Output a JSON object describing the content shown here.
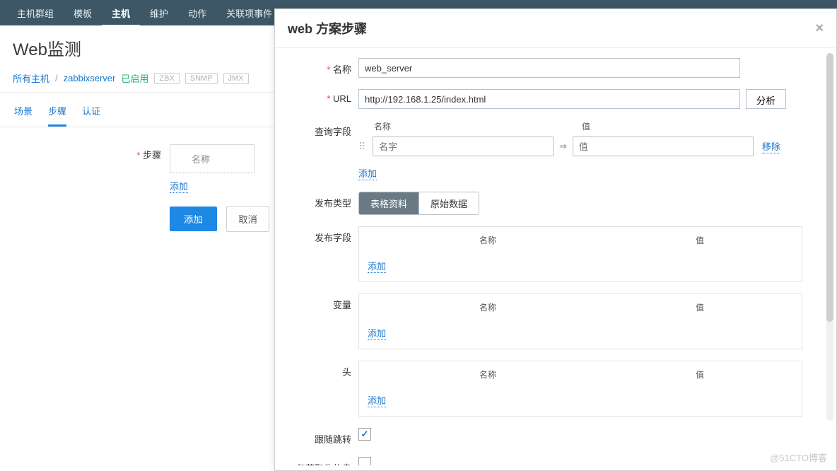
{
  "topnav": [
    "主机群组",
    "模板",
    "主机",
    "维护",
    "动作",
    "关联项事件"
  ],
  "topnav_active": 2,
  "page_title": "Web监测",
  "crumb": {
    "all_hosts": "所有主机",
    "server": "zabbixserver",
    "enabled": "已启用"
  },
  "badges": [
    "ZBX",
    "SNMP",
    "JMX"
  ],
  "subtabs": {
    "scene": "场景",
    "steps": "步骤",
    "auth": "认证",
    "active": 1
  },
  "back": {
    "steps_label": "步骤",
    "steps_col": "名称",
    "add": "添加",
    "cancel": "取消"
  },
  "modal": {
    "title": "web 方案步骤",
    "name_label": "名称",
    "name_value": "web_server",
    "url_label": "URL",
    "url_value": "http://192.168.1.25/index.html",
    "analyze": "分析",
    "query_label": "查询字段",
    "col_name": "名称",
    "col_value": "值",
    "ph_name": "名字",
    "ph_value": "值",
    "arrow": "⇒",
    "remove": "移除",
    "add": "添加",
    "post_type_label": "发布类型",
    "post_type_on": "表格资料",
    "post_type_off": "原始数据",
    "post_fields_label": "发布字段",
    "vars_label": "变量",
    "headers_label": "头",
    "follow_label": "跟随跳转",
    "follow_checked": true,
    "head_only_label": "仅获取头信息",
    "head_only_checked": false
  },
  "watermark": "@51CTO博客"
}
